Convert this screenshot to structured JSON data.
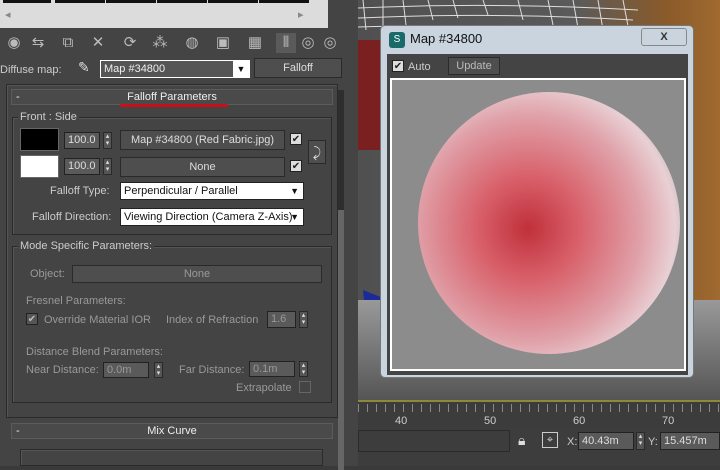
{
  "material_editor": {
    "diffuse_label": "Diffuse map:",
    "map_name": "Map #34800",
    "map_type": "Falloff",
    "rollout_falloff": "Falloff Parameters",
    "front_side_label": "Front : Side",
    "row1": {
      "amount": "100.0",
      "map": "Map #34800 (Red Fabric.jpg)",
      "checked": true
    },
    "row2": {
      "amount": "100.0",
      "map": "None",
      "checked": true
    },
    "falloff_type_label": "Falloff Type:",
    "falloff_type": "Perpendicular / Parallel",
    "falloff_direction_label": "Falloff Direction:",
    "falloff_direction": "Viewing Direction (Camera Z-Axis)",
    "mode_label": "Mode Specific Parameters:",
    "object_label": "Object:",
    "object_value": "None",
    "fresnel_label": "Fresnel Parameters:",
    "override_ior_label": "Override Material IOR",
    "ior_label": "Index of Refraction",
    "ior_value": "1.6",
    "distance_label": "Distance Blend Parameters:",
    "near_label": "Near Distance:",
    "near_value": "0.0m",
    "far_label": "Far Distance:",
    "far_value": "0.1m",
    "extrapolate_label": "Extrapolate",
    "rollout_mix": "Mix Curve",
    "collapse": "-"
  },
  "map_window": {
    "title": "Map #34800",
    "auto_label": "Auto",
    "update_label": "Update",
    "close": "X"
  },
  "ruler": {
    "ticks": [
      "40",
      "50",
      "60",
      "70"
    ]
  },
  "status": {
    "x_label": "X:",
    "x_value": "40.43m",
    "y_label": "Y:",
    "y_value": "15.457m"
  },
  "colors": {
    "accent_underline": "#c8101a",
    "panel": "#444444"
  }
}
